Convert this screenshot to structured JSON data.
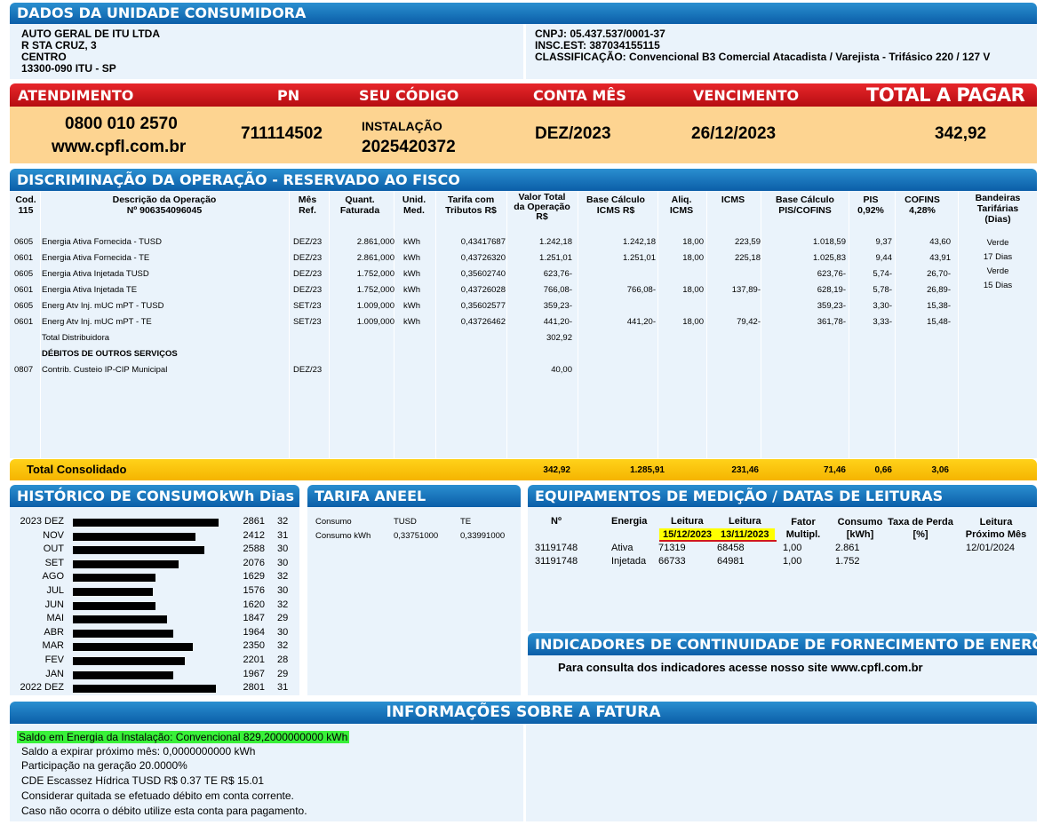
{
  "unidade": {
    "header": "DADOS DA UNIDADE CONSUMIDORA",
    "nome": "AUTO GERAL DE ITU LTDA",
    "endereco": "R STA CRUZ, 3",
    "bairro": "CENTRO",
    "cidade": "13300-090 ITU - SP",
    "cnpj": "CNPJ: 05.437.537/0001-37",
    "insc": "INSC.EST: 387034155115",
    "classificacao": "CLASSIFICAÇÃO: Convencional B3 Comercial Atacadista / Varejista - Trifásico 220 / 127 V"
  },
  "resumo": {
    "h_atendimento": "ATENDIMENTO",
    "h_pn": "PN",
    "h_codigo": "SEU CÓDIGO",
    "h_conta": "CONTA MÊS",
    "h_venc": "VENCIMENTO",
    "h_total": "TOTAL A PAGAR",
    "telefone": "0800 010 2570",
    "site": "www.cpfl.com.br",
    "pn": "711114502",
    "instalacao_label": "INSTALAÇÃO",
    "instalacao": "2025420372",
    "conta_mes": "DEZ/2023",
    "vencimento": "26/12/2023",
    "total": "342,92"
  },
  "discriminacao": {
    "header": "DISCRIMINAÇÃO DA OPERAÇÃO - RESERVADO AO FISCO",
    "cols": {
      "cod": "Cod.\n115",
      "desc": "Descrição da Operação\nNº 906354096045",
      "mes": "Mês\nRef.",
      "quant": "Quant.\nFaturada",
      "unid": "Unid.\nMed.",
      "tarifa": "Tarifa com\nTributos R$",
      "valor": "Valor Total\nda Operação\nR$",
      "base_icms": "Base Cálculo\nICMS R$",
      "aliq": "Aliq.\nICMS",
      "icms": "ICMS",
      "base_pis": "Base Cálculo\nPIS/COFINS",
      "pis": "PIS\n0,92%",
      "cofins": "COFINS\n4,28%",
      "bandeiras": "Bandeiras\nTarifárias\n(Dias)"
    },
    "rows": [
      [
        "0605",
        "Energia Ativa Fornecida - TUSD",
        "DEZ/23",
        "2.861,000",
        "kWh",
        "0,43417687",
        "1.242,18",
        "1.242,18",
        "18,00",
        "223,59",
        "1.018,59",
        "9,37",
        "43,60"
      ],
      [
        "0601",
        "Energia Ativa Fornecida - TE",
        "DEZ/23",
        "2.861,000",
        "kWh",
        "0,43726320",
        "1.251,01",
        "1.251,01",
        "18,00",
        "225,18",
        "1.025,83",
        "9,44",
        "43,91"
      ],
      [
        "0605",
        "Energia Ativa Injetada TUSD",
        "DEZ/23",
        "1.752,000",
        "kWh",
        "0,35602740",
        "623,76-",
        "",
        "",
        "",
        "623,76-",
        "5,74-",
        "26,70-"
      ],
      [
        "0601",
        "Energia Ativa Injetada TE",
        "DEZ/23",
        "1.752,000",
        "kWh",
        "0,43726028",
        "766,08-",
        "766,08-",
        "18,00",
        "137,89-",
        "628,19-",
        "5,78-",
        "26,89-"
      ],
      [
        "0605",
        "Energ Atv Inj. mUC mPT - TUSD",
        "SET/23",
        "1.009,000",
        "kWh",
        "0,35602577",
        "359,23-",
        "",
        "",
        "",
        "359,23-",
        "3,30-",
        "15,38-"
      ],
      [
        "0601",
        "Energ Atv Inj. mUC mPT - TE",
        "SET/23",
        "1.009,000",
        "kWh",
        "0,43726462",
        "441,20-",
        "441,20-",
        "18,00",
        "79,42-",
        "361,78-",
        "3,33-",
        "15,48-"
      ],
      [
        "",
        "Total Distribuidora",
        "",
        "",
        "",
        "",
        "302,92",
        "",
        "",
        "",
        "",
        "",
        ""
      ],
      [
        "",
        "DÉBITOS DE OUTROS SERVIÇOS",
        "",
        "",
        "",
        "",
        "",
        "",
        "",
        "",
        "",
        "",
        ""
      ],
      [
        "0807",
        "Contrib. Custeio IP-CIP Municipal",
        "DEZ/23",
        "",
        "",
        "",
        "40,00",
        "",
        "",
        "",
        "",
        "",
        ""
      ]
    ],
    "bandeiras": [
      "Verde",
      "17 Dias",
      "Verde",
      "15 Dias"
    ],
    "total_label": "Total Consolidado",
    "total": [
      "342,92",
      "1.285,91",
      "231,46",
      "71,46",
      "0,66",
      "3,06"
    ]
  },
  "historico": {
    "header": "HISTÓRICO DE CONSUMO",
    "header_right": "kWh Dias",
    "rows": [
      {
        "mes": "2023 DEZ",
        "kwh": "2861",
        "dias": "32",
        "v": 2861
      },
      {
        "mes": "NOV",
        "kwh": "2412",
        "dias": "31",
        "v": 2412
      },
      {
        "mes": "OUT",
        "kwh": "2588",
        "dias": "30",
        "v": 2588
      },
      {
        "mes": "SET",
        "kwh": "2076",
        "dias": "30",
        "v": 2076
      },
      {
        "mes": "AGO",
        "kwh": "1629",
        "dias": "32",
        "v": 1629
      },
      {
        "mes": "JUL",
        "kwh": "1576",
        "dias": "30",
        "v": 1576
      },
      {
        "mes": "JUN",
        "kwh": "1620",
        "dias": "32",
        "v": 1620
      },
      {
        "mes": "MAI",
        "kwh": "1847",
        "dias": "29",
        "v": 1847
      },
      {
        "mes": "ABR",
        "kwh": "1964",
        "dias": "30",
        "v": 1964
      },
      {
        "mes": "MAR",
        "kwh": "2350",
        "dias": "32",
        "v": 2350
      },
      {
        "mes": "FEV",
        "kwh": "2201",
        "dias": "28",
        "v": 2201
      },
      {
        "mes": "JAN",
        "kwh": "1967",
        "dias": "29",
        "v": 1967
      },
      {
        "mes": "2022 DEZ",
        "kwh": "2801",
        "dias": "31",
        "v": 2801
      }
    ],
    "max": 2861
  },
  "tarifa": {
    "header": "TARIFA ANEEL",
    "c1": "Consumo",
    "c2": "TUSD",
    "c3": "TE",
    "r1": "Consumo kWh",
    "tusd": "0,33751000",
    "te": "0,33991000"
  },
  "equipamentos": {
    "header": "EQUIPAMENTOS DE MEDIÇÃO / DATAS DE LEITURAS",
    "h_n": "Nº",
    "h_energia": "Energia",
    "h_leitura1": "Leitura",
    "h_leitura2": "Leitura",
    "d1": "15/12/2023",
    "d2": "13/11/2023",
    "h_fator": "Fator\nMultipl.",
    "h_consumo": "Consumo\n[kWh]",
    "h_taxa": "Taxa de Perda\n[%]",
    "h_prox": "Leitura\nPróximo Mês",
    "rows": [
      [
        "31191748",
        "Ativa",
        "71319",
        "68458",
        "1,00",
        "2.861"
      ],
      [
        "31191748",
        "Injetada",
        "66733",
        "64981",
        "1,00",
        "1.752"
      ]
    ],
    "proxima": "12/01/2024"
  },
  "indicadores": {
    "header": "INDICADORES DE CONTINUIDADE DE FORNECIMENTO DE ENERGIA",
    "texto": "Para consulta dos indicadores acesse nosso site www.cpfl.com.br"
  },
  "informacoes": {
    "header": "INFORMAÇÕES SOBRE A FATURA",
    "destaque": "Saldo em Energia da Instalação: Convencional 829,2000000000 kWh",
    "linhas": [
      "Saldo a expirar próximo mês: 0,0000000000 kWh",
      "Participação na geração 20.0000%",
      "CDE Escassez Hídrica  TUSD R$ 0.37  TE R$ 15.01",
      "Considerar quitada se efetuado débito em conta corrente.",
      "Caso não ocorra o débito utilize esta conta para pagamento."
    ]
  },
  "colors": {
    "blue": "#1a78c2",
    "red": "#d0181c",
    "orange_bg": "#fdd491",
    "yellow": "#f7c000",
    "panel": "#eaf3fb",
    "highlight_green": "#39f039",
    "highlight_yellow": "#ffff00"
  }
}
